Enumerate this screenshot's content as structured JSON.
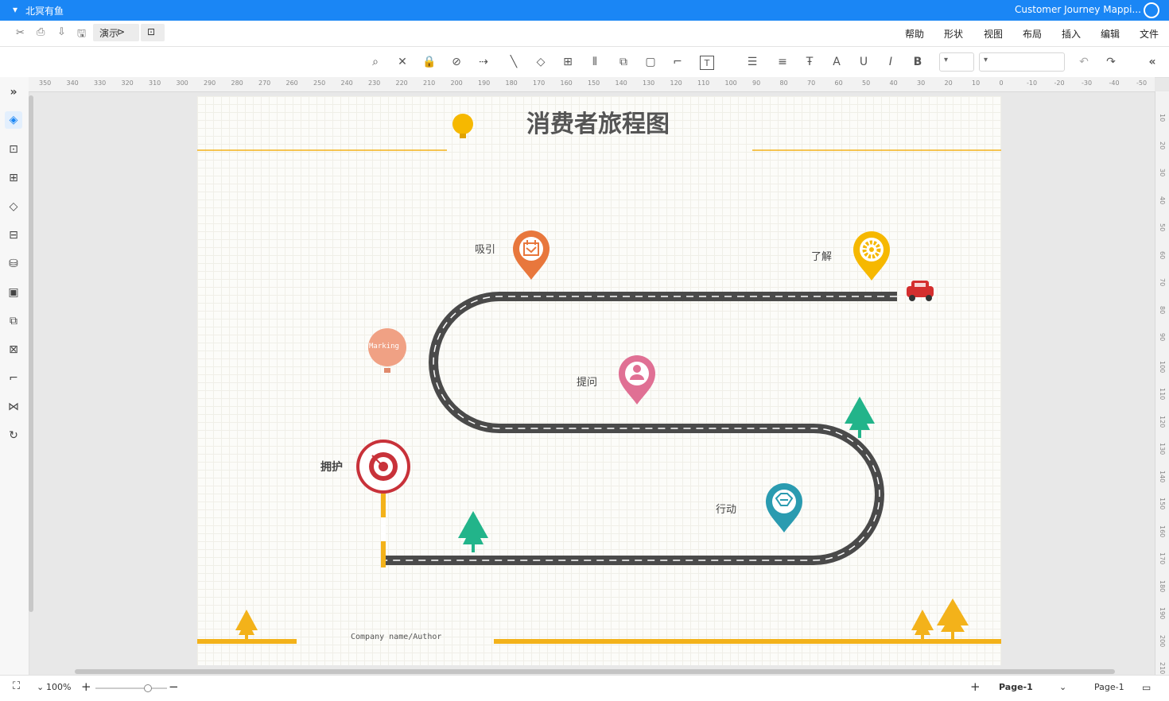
{
  "titlebar": {
    "doc_title": "Customer Journey Mappi...",
    "account": "北冥有鱼"
  },
  "menubar": {
    "items": [
      "文件",
      "编辑",
      "插入",
      "布局",
      "视图",
      "形状",
      "帮助"
    ],
    "present_label": "演示",
    "present_icon": "play-icon"
  },
  "toolbar": {
    "font_select": "",
    "size_select": ""
  },
  "ruler": {
    "h_ticks": [
      "-50",
      "-40",
      "-30",
      "-20",
      "-10",
      "0",
      "10",
      "20",
      "30",
      "40",
      "50",
      "60",
      "70",
      "80",
      "90",
      "100",
      "110",
      "120",
      "130",
      "140",
      "150",
      "160",
      "170",
      "180",
      "190",
      "200",
      "210",
      "220",
      "230",
      "240",
      "250",
      "260",
      "270",
      "280",
      "290",
      "300",
      "310",
      "320",
      "330",
      "340",
      "350"
    ],
    "v_ticks": [
      "10",
      "20",
      "30",
      "40",
      "50",
      "60",
      "70",
      "80",
      "90",
      "100",
      "110",
      "120",
      "130",
      "140",
      "150",
      "160",
      "170",
      "180",
      "190",
      "200",
      "210"
    ]
  },
  "diagram": {
    "title": "消费者旅程图",
    "stages": {
      "understand": "了解",
      "attract": "吸引",
      "ask": "提问",
      "act": "行动",
      "maintain": "拥护"
    },
    "marking_label": "Marking",
    "footer": "Company name/Author",
    "colors": {
      "road": "#4a4a4a",
      "accent_yellow": "#f3b21a",
      "pin_yellow": "#f6b800",
      "pin_orange": "#e8773c",
      "pin_pink": "#e07094",
      "pin_teal": "#2a9bb0",
      "balloon": "#f0a184",
      "target_red": "#c8323a",
      "tree_green": "#22b48a",
      "car_red": "#d42e2e"
    }
  },
  "statusbar": {
    "page_tab": "Page-1",
    "page_tab_active": "Page-1",
    "zoom": "100%"
  }
}
